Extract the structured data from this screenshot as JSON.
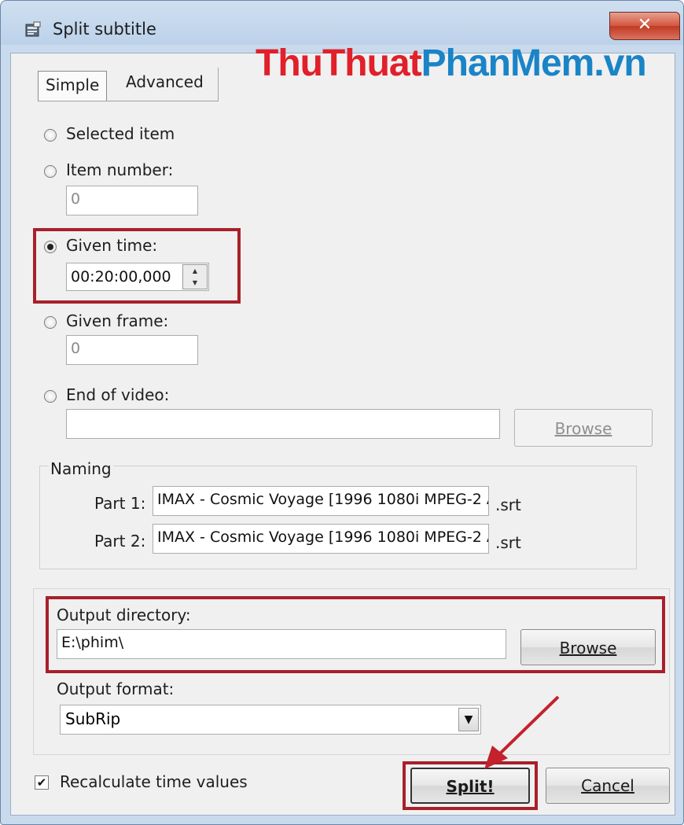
{
  "window": {
    "title": "Split subtitle",
    "close_glyph": "✕"
  },
  "watermark": {
    "part1": "ThuThuat",
    "part2": "PhanMem.vn"
  },
  "tabs": [
    {
      "label": "Simple"
    },
    {
      "label": "Advanced"
    }
  ],
  "options": {
    "selected_item": {
      "label": "Selected item",
      "checked": false
    },
    "item_number": {
      "label": "Item number:",
      "value": "0",
      "checked": false
    },
    "given_time": {
      "label": "Given time:",
      "value": "00:20:00,000",
      "checked": true
    },
    "given_frame": {
      "label": "Given frame:",
      "value": "0",
      "checked": false
    },
    "end_of_video": {
      "label": "End of video:",
      "value": "",
      "browse_label": "Browse",
      "checked": false
    }
  },
  "naming": {
    "title": "Naming",
    "parts": [
      {
        "label": "Part 1:",
        "value": "IMAX - Cosmic Voyage [1996 1080i MPEG-2 A",
        "ext": ".srt"
      },
      {
        "label": "Part 2:",
        "value": "IMAX - Cosmic Voyage [1996 1080i MPEG-2 A",
        "ext": ".srt"
      }
    ]
  },
  "output": {
    "directory_label": "Output directory:",
    "directory_value": "E:\\phim\\",
    "browse_label": "Browse",
    "format_label": "Output format:",
    "format_value": "SubRip",
    "combo_glyph": "▼"
  },
  "footer": {
    "recalc_label": "Recalculate time values",
    "recalc_checked": true,
    "check_glyph": "✔",
    "split_label": "Split!",
    "cancel_label": "Cancel"
  },
  "colors": {
    "highlight": "#a8202a",
    "watermark_red": "#e0202a",
    "watermark_blue": "#1a84c7"
  }
}
